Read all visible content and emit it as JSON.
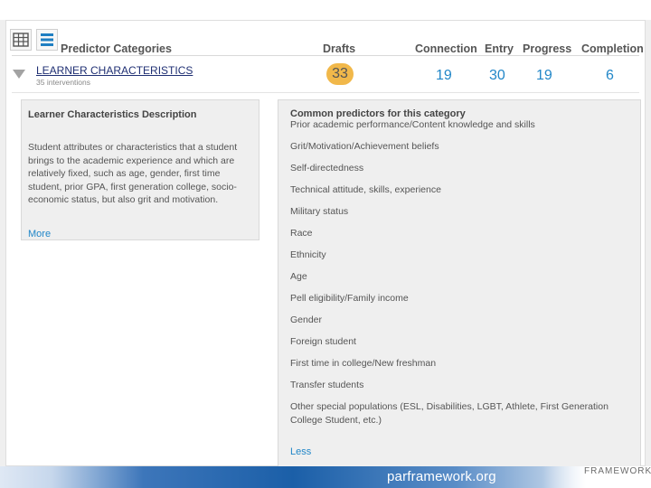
{
  "header": {
    "category": "Predictor Categories",
    "drafts": "Drafts",
    "connection": "Connection",
    "entry": "Entry",
    "progress": "Progress",
    "completion": "Completion"
  },
  "row": {
    "title": "LEARNER CHARACTERISTICS",
    "subtitle": "35 interventions",
    "drafts": "33",
    "connection": "19",
    "entry": "30",
    "progress": "19",
    "completion": "6",
    "badge_color": "#f1b84a"
  },
  "description": {
    "title": "Learner Characteristics Description",
    "text": "Student attributes or characteristics that a student brings to the academic experience and which are relatively fixed, such as age, gender, first time student, prior GPA, first generation college, socio-economic status, but also grit and motivation.",
    "more": "More"
  },
  "predictors": {
    "title": "Common predictors for this category",
    "items": [
      "Prior academic performance/Content knowledge and skills",
      "Grit/Motivation/Achievement beliefs",
      "Self-directedness",
      "Technical attitude, skills, experience",
      "Military status",
      "Race",
      "Ethnicity",
      "Age",
      "Pell eligibility/Family income",
      "Gender",
      "Foreign student",
      "First time in college/New freshman",
      "Transfer students",
      "Other special populations (ESL, Disabilities, LGBT, Athlete, First Generation College Student, etc.)"
    ],
    "less": "Less"
  },
  "footer": {
    "url": "parframework.org",
    "mark": "FRAMEWORK"
  },
  "icons": {
    "grid": "grid-view-icon",
    "list": "list-view-icon",
    "expand": "triangle-down-icon"
  },
  "colors": {
    "accent": "#2287c8",
    "title_link": "#1f2f73",
    "footer": "#1b5fa8"
  }
}
